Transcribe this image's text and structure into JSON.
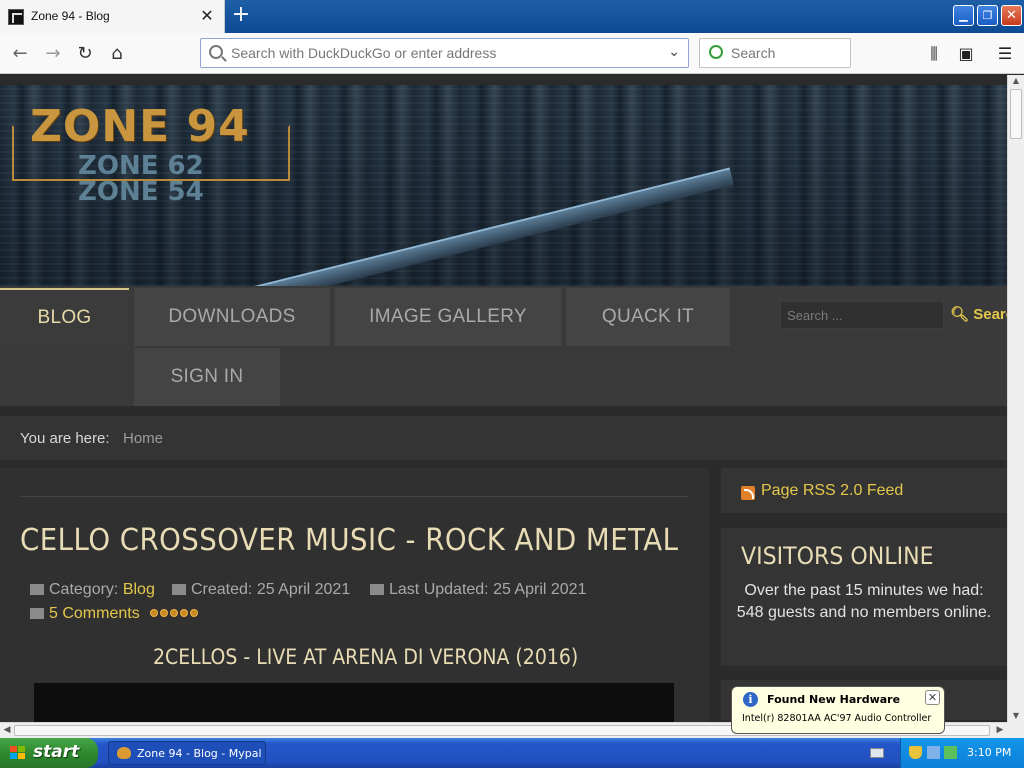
{
  "browser": {
    "tab_title": "Zone 94 - Blog",
    "url_placeholder": "Search with DuckDuckGo or enter address",
    "search_placeholder": "Search"
  },
  "site": {
    "logo_main": "ZONE 94",
    "logo_sub1": "ZONE 62",
    "logo_sub2": "ZONE 54",
    "menu": [
      {
        "label": "BLOG",
        "active": true
      },
      {
        "label": "DOWNLOADS"
      },
      {
        "label": "IMAGE GALLERY"
      },
      {
        "label": "QUACK IT"
      },
      {
        "label": "SIGN IN"
      }
    ],
    "search_placeholder": "Search ...",
    "search_button": "Search",
    "accent_color": "#e5c84b"
  },
  "breadcrumb": {
    "label": "You are here:",
    "home": "Home"
  },
  "article": {
    "title": "CELLO CROSSOVER MUSIC - ROCK AND METAL",
    "category_label": "Category:",
    "category": "Blog",
    "created": "Created: 25 April 2021",
    "updated": "Last Updated: 25 April 2021",
    "comments": "5 Comments",
    "rating_stars": 5,
    "subtitle": "2CELLOS - LIVE AT ARENA DI VERONA (2016)"
  },
  "sidebar": {
    "rss": "Page RSS 2.0 Feed",
    "visitors_title": "VISITORS ONLINE",
    "visitors_text": "Over the past 15 minutes we had: 548 guests and no members online."
  },
  "notification": {
    "title": "Found New Hardware",
    "body": "Intel(r) 82801AA AC'97 Audio Controller"
  },
  "taskbar": {
    "start": "start",
    "window": "Zone 94 - Blog - Mypal",
    "clock": "3:10 PM"
  }
}
